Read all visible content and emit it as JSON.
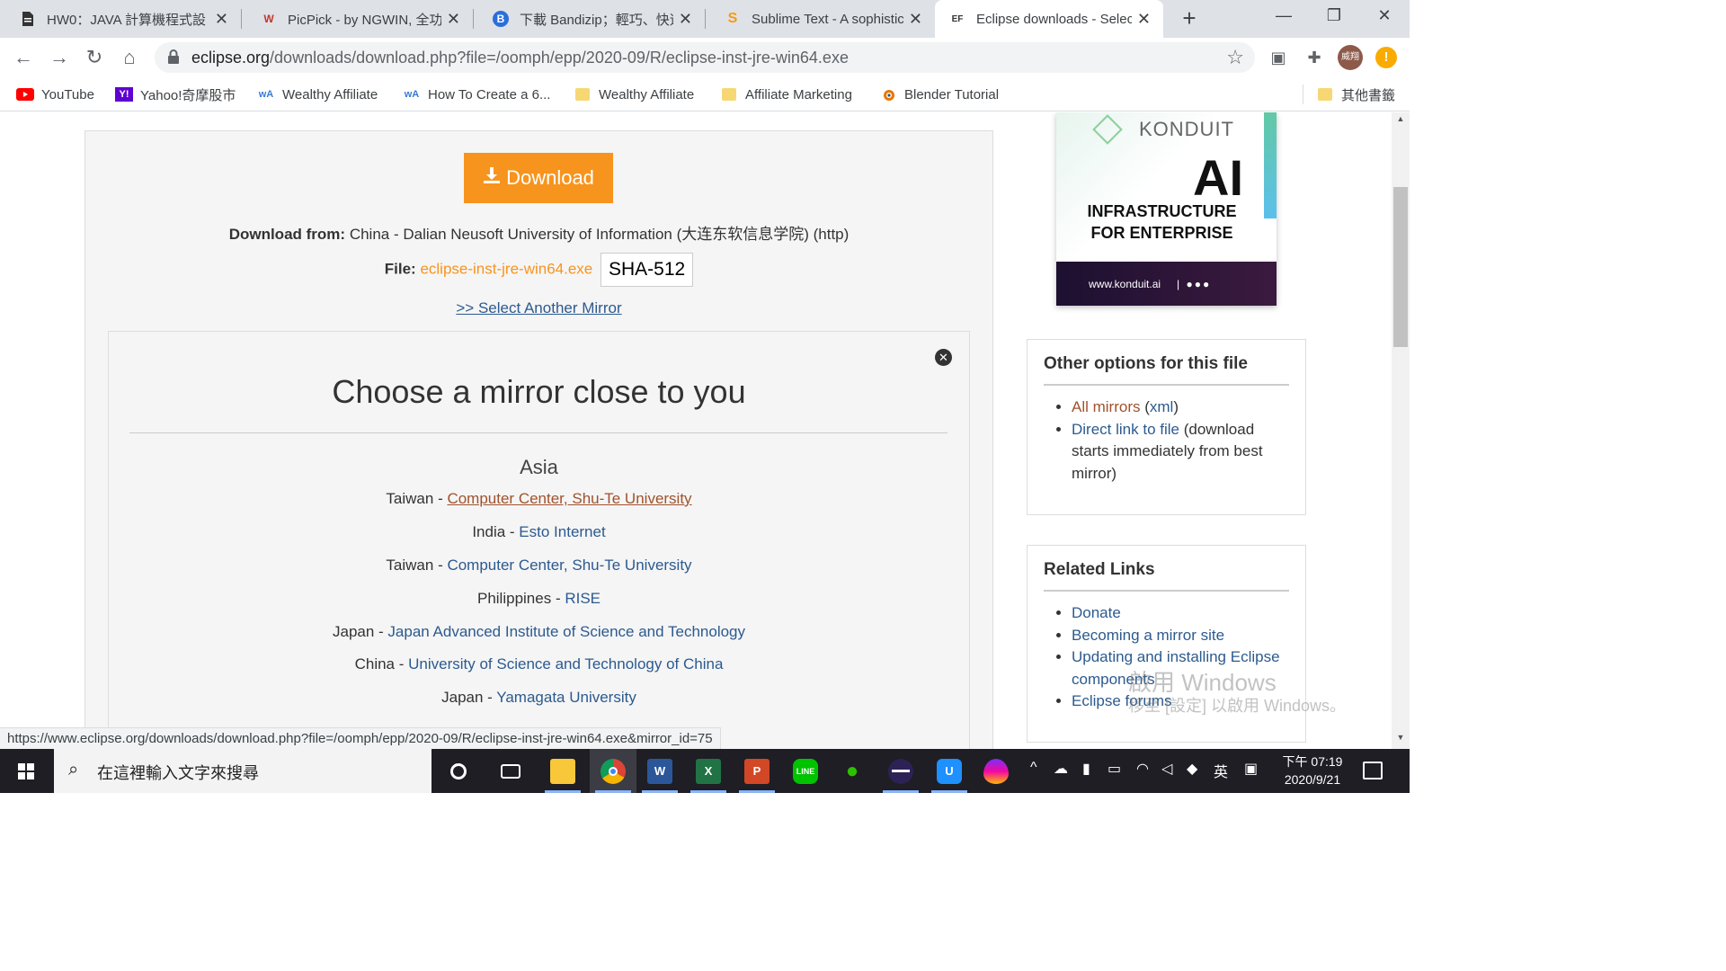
{
  "browser": {
    "tabs": [
      {
        "title": "HW0：JAVA 計算機程式設",
        "icon": "document-icon",
        "active": false
      },
      {
        "title": "PicPick - by NGWIN, 全功",
        "icon": "picpick-icon",
        "active": false
      },
      {
        "title": "下載 Bandizip；輕巧、快速",
        "icon": "bandizip-icon",
        "active": false
      },
      {
        "title": "Sublime Text - A sophistic",
        "icon": "sublime-icon",
        "active": false
      },
      {
        "title": "Eclipse downloads - Selec",
        "icon": "eclipse-foundation-icon",
        "active": true
      }
    ],
    "url_host": "eclipse.org",
    "url_path": "/downloads/download.php?file=/oomph/epp/2020-09/R/eclipse-inst-jre-win64.exe",
    "avatar_text": "威翔",
    "update_badge": "!",
    "bookmarks": [
      {
        "label": "YouTube",
        "icon": "youtube-icon"
      },
      {
        "label": "Yahoo!奇摩股市",
        "icon": "yahoo-icon"
      },
      {
        "label": "Wealthy Affiliate",
        "icon": "wa-icon"
      },
      {
        "label": "How To Create a 6...",
        "icon": "wa-icon"
      },
      {
        "label": "Wealthy Affiliate",
        "icon": "folder-icon"
      },
      {
        "label": "Affiliate Marketing",
        "icon": "folder-icon"
      },
      {
        "label": "Blender Tutorial",
        "icon": "blender-icon"
      }
    ],
    "other_bookmarks": "其他書籤",
    "status_url": "https://www.eclipse.org/downloads/download.php?file=/oomph/epp/2020-09/R/eclipse-inst-jre-win64.exe&mirror_id=75"
  },
  "download": {
    "button_label": "Download",
    "from_label": "Download from:",
    "from_value": "China - Dalian Neusoft University of Information (大连东软信息学院) (http)",
    "file_label": "File:",
    "file_name": "eclipse-inst-jre-win64.exe",
    "sha_label": "SHA-512",
    "select_mirror": ">> Select Another Mirror"
  },
  "mirrors": {
    "title": "Choose a mirror close to you",
    "region": "Asia",
    "items": [
      {
        "country": "Taiwan",
        "name": "Computer Center, Shu-Te University"
      },
      {
        "country": "India",
        "name": "Esto Internet"
      },
      {
        "country": "Taiwan",
        "name": "Computer Center, Shu-Te University"
      },
      {
        "country": "Philippines",
        "name": "RISE"
      },
      {
        "country": "Japan",
        "name": "Japan Advanced Institute of Science and Technology"
      },
      {
        "country": "China",
        "name": "University of Science and Technology of China"
      },
      {
        "country": "Japan",
        "name": "Yamagata University"
      }
    ]
  },
  "ad": {
    "brand": "KONDUIT",
    "headline": "AI",
    "line1": "INFRASTRUCTURE",
    "line2": "FOR ENTERPRISE",
    "site": "www.konduit.ai",
    "divider": "|"
  },
  "other_options": {
    "title": "Other options for this file",
    "all_mirrors": "All mirrors",
    "xml": "xml",
    "direct_link": "Direct link to file",
    "direct_note": "(download starts immediately from best mirror)"
  },
  "related": {
    "title": "Related Links",
    "links": [
      "Donate",
      "Becoming a mirror site",
      "Updating and installing Eclipse components",
      "Eclipse forums"
    ]
  },
  "watermark": {
    "line1": "啟用 Windows",
    "line2": "移至 [設定] 以啟用 Windows。"
  },
  "taskbar": {
    "search_placeholder": "在這裡輸入文字來搜尋",
    "ime": "英",
    "time": "下午 07:19",
    "date": "2020/9/21"
  },
  "colors": {
    "accent_orange": "#f7941e",
    "link_blue": "#2c5a8f",
    "visited_link": "#a0522d"
  }
}
